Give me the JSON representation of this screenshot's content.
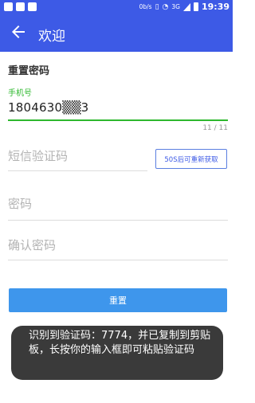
{
  "status_bar": {
    "speed": "0b/s",
    "network": "3G",
    "time": "19:39"
  },
  "app_bar": {
    "title": "欢迎"
  },
  "form": {
    "section_title": "重置密码",
    "phone_label": "手机号",
    "phone_value": "1804630▒▒3",
    "phone_counter": "11 / 11",
    "code_placeholder": "短信验证码",
    "resend_label": "50S后可重新获取",
    "password_placeholder": "密码",
    "confirm_placeholder": "确认密码",
    "reset_label": "重置"
  },
  "toast": {
    "message": "识别到验证码：7774，并已复制到剪贴板，长按你的输入框即可粘贴验证码"
  },
  "colors": {
    "primary": "#3d5ae6",
    "accent_green": "#2eb82e",
    "button_blue": "#3e96ec",
    "toast_bg": "#3a3a3a"
  }
}
